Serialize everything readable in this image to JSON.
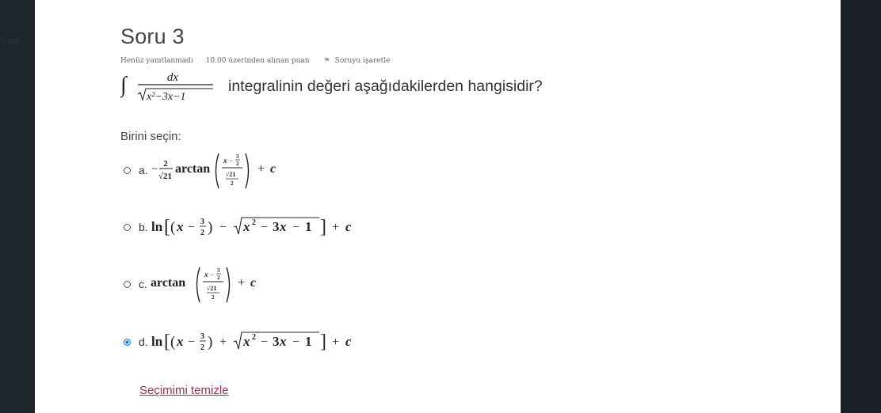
{
  "question": {
    "title": "Soru 3",
    "status": "Henüz yanıtlanmadı",
    "points": "10.00 üzerinden alınan puan",
    "flag_label": "Soruyu işaretle",
    "text": "integralinin değeri aşağıdakilerden hangisidir?",
    "integral": {
      "sign": "∫",
      "numerator": "dx",
      "radicand": "x²−3x−1"
    }
  },
  "answer": {
    "prompt": "Birini seçin:",
    "clear_label": "Seçimimi temizle",
    "selected": "d",
    "options": [
      {
        "letter": "a.",
        "formula": "−(2/√21) arctan((x−3/2)/(√21/2)) + c"
      },
      {
        "letter": "b.",
        "formula": "ln[(x − 3/2) − √(x² − 3x − 1)] + c"
      },
      {
        "letter": "c.",
        "formula": "arctan((x−3/2)/(√21/2)) + c"
      },
      {
        "letter": "d.",
        "formula": "ln[(x − 3/2) + √(x² − 3x − 1)] + c"
      }
    ]
  },
  "colors": {
    "link": "#9b2c5d",
    "radio_selected": "#1177d1",
    "page_background": "#1b2127"
  },
  "left_strip_text": "Lalla"
}
